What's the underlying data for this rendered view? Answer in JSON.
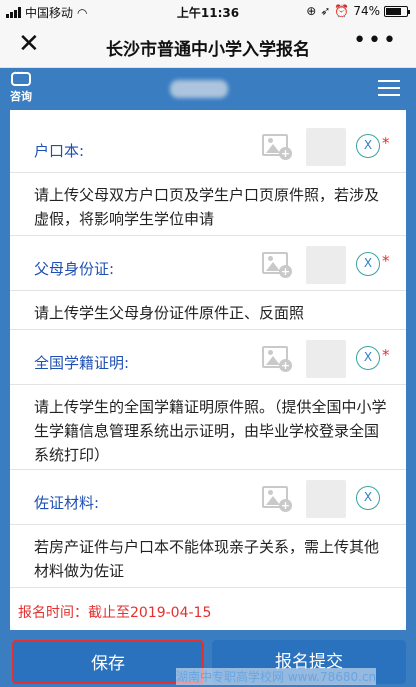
{
  "status_bar": {
    "carrier": "中国移动",
    "time": "上午11:36",
    "battery": "74%"
  },
  "titlebar": {
    "title": "长沙市普通中小学入学报名",
    "more": "•••"
  },
  "header": {
    "consult_label": "咨询"
  },
  "fields": [
    {
      "label": "户口本:",
      "description": "请上传父母双方户口页及学生户口页原件照，若涉及虚假，将影响学生学位申请",
      "required": true
    },
    {
      "label": "父母身份证:",
      "description": "请上传学生父母身份证件原件正、反面照",
      "required": true
    },
    {
      "label": "全国学籍证明:",
      "description": "请上传学生的全国学籍证明原件照。（提供全国中小学生学籍信息管理系统出示证明，由毕业学校登录全国系统打印）",
      "required": true
    },
    {
      "label": "佐证材料:",
      "description": "若房产证件与户口本不能体现亲子关系，需上传其他材料做为佐证",
      "required": false
    }
  ],
  "remove_label": "X",
  "required_mark": "*",
  "deadline": "报名时间：截止至2019-04-15",
  "buttons": {
    "save": "保存",
    "submit": "报名提交"
  },
  "watermark": "湖南中专职高学校网 www.78680.cn",
  "colors": {
    "accent": "#3a7dc1",
    "label_blue": "#1e50b4",
    "required_red": "#e53030"
  }
}
